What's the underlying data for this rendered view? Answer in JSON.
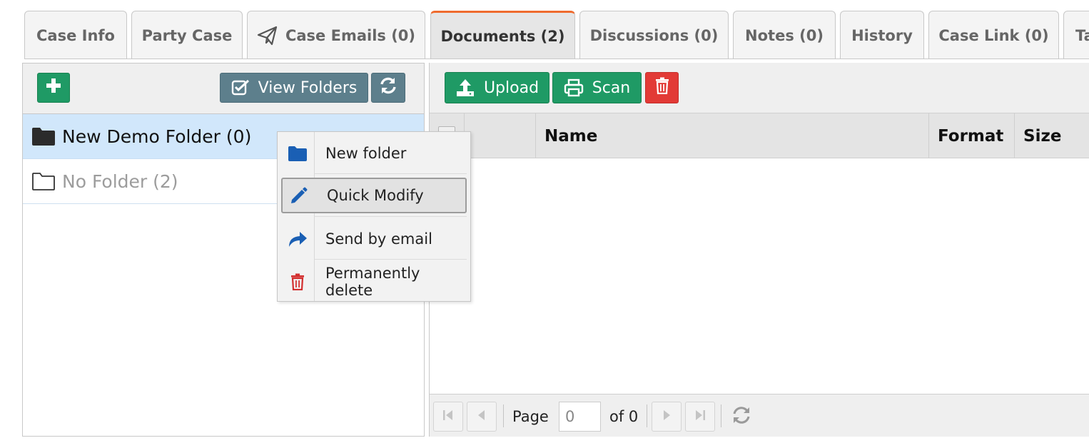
{
  "tabs": [
    {
      "label": "Case Info"
    },
    {
      "label": "Party Case"
    },
    {
      "label": "Case Emails (0)",
      "icon": "paper-plane-icon"
    },
    {
      "label": "Documents (2)",
      "active": true
    },
    {
      "label": "Discussions (0)"
    },
    {
      "label": "Notes (0)"
    },
    {
      "label": "History"
    },
    {
      "label": "Case Link (0)"
    },
    {
      "label": "Ta"
    }
  ],
  "folders_toolbar": {
    "add_icon": "plus-icon",
    "view_folders_label": "View Folders",
    "view_folders_icon": "checkbox-icon",
    "refresh_icon": "refresh-icon"
  },
  "folders": [
    {
      "label": "New Demo Folder (0)",
      "selected": true,
      "icon": "folder-solid-icon"
    },
    {
      "label": "No Folder (2)",
      "selected": false,
      "icon": "folder-outline-icon"
    }
  ],
  "documents_toolbar": {
    "upload_label": "Upload",
    "scan_label": "Scan",
    "delete_icon": "trash-icon"
  },
  "grid": {
    "columns": [
      "Name",
      "Format",
      "Size"
    ]
  },
  "pager": {
    "page_label": "Page",
    "page_value": "0",
    "of_label": "of 0"
  },
  "context_menu": {
    "items": [
      {
        "label": "New folder",
        "icon": "folder-icon",
        "color": "#1a5fb4"
      },
      {
        "label": "Quick Modify",
        "icon": "pencil-icon",
        "color": "#1a5fb4",
        "highlighted": true
      },
      {
        "label": "Send by email",
        "icon": "share-icon",
        "color": "#1a5fb4"
      },
      {
        "label": "Permanently delete",
        "icon": "trash-icon",
        "color": "#d32f2f"
      }
    ]
  },
  "colors": {
    "active_tab_accent": "#ef6b2e",
    "primary_green": "#1f9a65",
    "slate": "#5d7f8c",
    "danger_red": "#e23a36",
    "selection_blue": "#d1e7fb"
  }
}
